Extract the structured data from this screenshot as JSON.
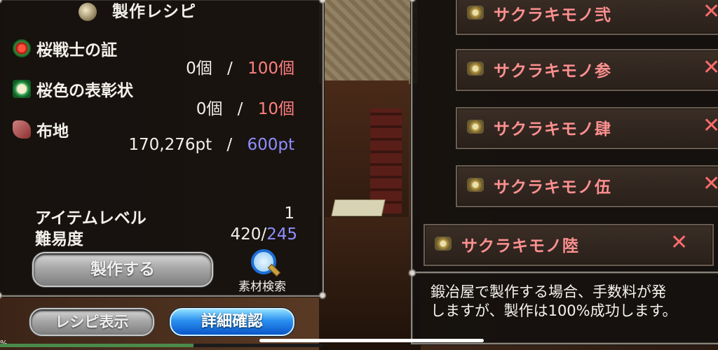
{
  "recipe_panel": {
    "title": "製作レシピ",
    "materials": [
      {
        "name": "桜戦士の証",
        "have": "0個",
        "sep": "/",
        "need": "100個",
        "need_color": "#ff8080"
      },
      {
        "name": "桜色の表彰状",
        "have": "0個",
        "sep": "/",
        "need": "10個",
        "need_color": "#ff8080"
      },
      {
        "name": "布地",
        "have": "170,276pt",
        "sep": "/",
        "need": "600pt",
        "need_color": "#8f8fff"
      }
    ],
    "item_level": {
      "label": "アイテムレベル",
      "value": "1"
    },
    "difficulty": {
      "label": "難易度",
      "value": "420",
      "sep": "/",
      "target": "245"
    },
    "craft_button": "製作する",
    "material_search": "素材検索"
  },
  "bottom_buttons": {
    "recipe_display": "レシピ表示",
    "detail_check": "詳細確認"
  },
  "list_panel": {
    "items": [
      {
        "name": "サクラキモノ弐",
        "remove": "✕"
      },
      {
        "name": "サクラキモノ参",
        "remove": "✕"
      },
      {
        "name": "サクラキモノ肆",
        "remove": "✕"
      },
      {
        "name": "サクラキモノ伍",
        "remove": "✕"
      },
      {
        "name": "サクラキモノ陸",
        "remove": "✕"
      }
    ]
  },
  "description": {
    "text": "鍛冶屋で製作する場合、手数料が発\nしますが、製作は100%成功します。"
  },
  "footer": {
    "edge_text": "%",
    "progress_fraction": 0.6
  },
  "colors": {
    "accent_red": "#ff8080",
    "accent_blue": "#8f8fff",
    "item_pink": "#ff9090"
  }
}
